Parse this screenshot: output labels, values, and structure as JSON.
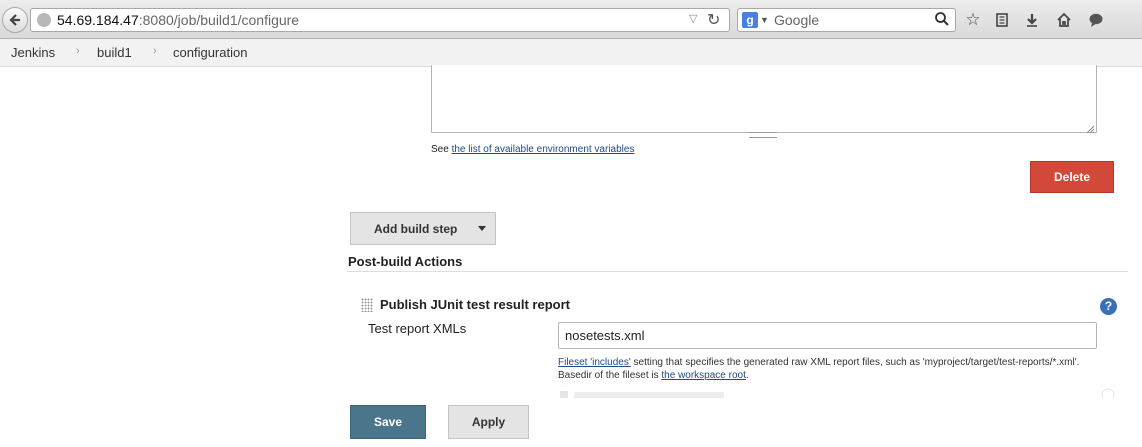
{
  "browser": {
    "url_host": "54.69.184.47",
    "url_rest": ":8080/job/build1/configure",
    "search_engine": "Google",
    "icons": [
      "back-icon",
      "globe-icon",
      "dropdown-icon",
      "reload-icon",
      "google-icon",
      "search-icon",
      "bookmark-star-icon",
      "reading-list-icon",
      "download-icon",
      "home-icon",
      "chat-icon"
    ]
  },
  "breadcrumb": {
    "items": [
      "Jenkins",
      "build1",
      "configuration"
    ],
    "separator": "›"
  },
  "shell_step": {
    "env_prefix": "See ",
    "env_link": "the list of available environment variables",
    "delete_label": "Delete"
  },
  "builders": {
    "add_build_step_label": "Add build step"
  },
  "post_build": {
    "section_title": "Post-build Actions",
    "junit": {
      "title": "Publish JUnit test result report",
      "help_glyph": "?",
      "test_report_label": "Test report XMLs",
      "test_report_value": "nosetests.xml",
      "note_link_1": "Fileset 'includes'",
      "note_mid": " setting that specifies the generated raw XML report files, such as 'myproject/target/test-reports/*.xml'. Basedir of the fileset is ",
      "note_link_2": "the workspace root",
      "note_end": "."
    }
  },
  "footer": {
    "save_label": "Save",
    "apply_label": "Apply"
  },
  "colors": {
    "delete": "#d24939",
    "save": "#4b758b",
    "link": "#204a87",
    "help": "#3b6fb6"
  }
}
